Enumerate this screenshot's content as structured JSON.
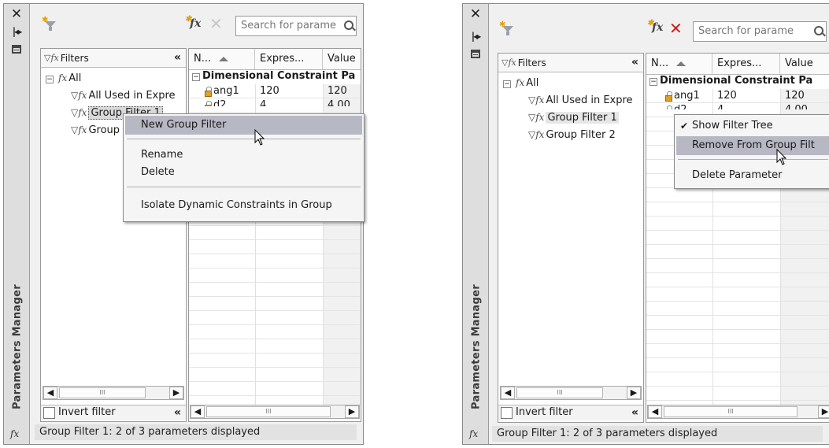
{
  "panels": [
    {
      "title": "Parameters Manager",
      "title_icon": "fx",
      "toolbar": {
        "search_placeholder": "Search for parame",
        "delete_icon_color": "#c8c8c8"
      },
      "filters": {
        "header": "Filters",
        "tree": [
          {
            "label": "All",
            "icon": "fx-icon"
          },
          {
            "label": "All Used in Expre",
            "icon": "filter-icon"
          },
          {
            "label": "Group Filter 1",
            "icon": "filter-icon",
            "selected": true
          },
          {
            "label": "Group",
            "icon": "filter-icon"
          }
        ],
        "invert_label": "Invert filter"
      },
      "grid": {
        "columns": [
          "N...",
          "Expres...",
          "Value"
        ],
        "group": "Dimensional Constraint Pa",
        "rows": [
          {
            "name": "ang1",
            "expression": "120",
            "value": "120"
          },
          {
            "name": "d2",
            "expression": "4",
            "value": "4.00"
          }
        ]
      },
      "context_menu": {
        "items": [
          "New Group Filter",
          "Rename",
          "Delete",
          "Isolate Dynamic Constraints in Group"
        ],
        "highlighted": "New Group Filter"
      },
      "status": "Group Filter 1: 2 of 3 parameters displayed"
    },
    {
      "title": "Parameters Manager",
      "title_icon": "fx",
      "toolbar": {
        "search_placeholder": "Search for parame",
        "delete_icon_color": "#d01818"
      },
      "filters": {
        "header": "Filters",
        "tree": [
          {
            "label": "All",
            "icon": "fx-icon"
          },
          {
            "label": "All Used in Expre",
            "icon": "filter-icon"
          },
          {
            "label": "Group Filter 1",
            "icon": "filter-icon",
            "selected": true
          },
          {
            "label": "Group Filter 2",
            "icon": "filter-icon"
          }
        ],
        "invert_label": "Invert filter"
      },
      "grid": {
        "columns": [
          "N...",
          "Expres...",
          "Value"
        ],
        "group": "Dimensional Constraint Pa",
        "rows": [
          {
            "name": "ang1",
            "expression": "120",
            "value": "120"
          },
          {
            "name": "d2",
            "expression": "4",
            "value": "4.00"
          }
        ]
      },
      "context_menu": {
        "items": [
          "Show Filter Tree",
          "Remove From Group Filt",
          "Delete Parameter"
        ],
        "checked": "Show Filter Tree",
        "highlighted": "Remove From Group Filt"
      },
      "status": "Group Filter 1: 2 of 3 parameters displayed"
    }
  ]
}
